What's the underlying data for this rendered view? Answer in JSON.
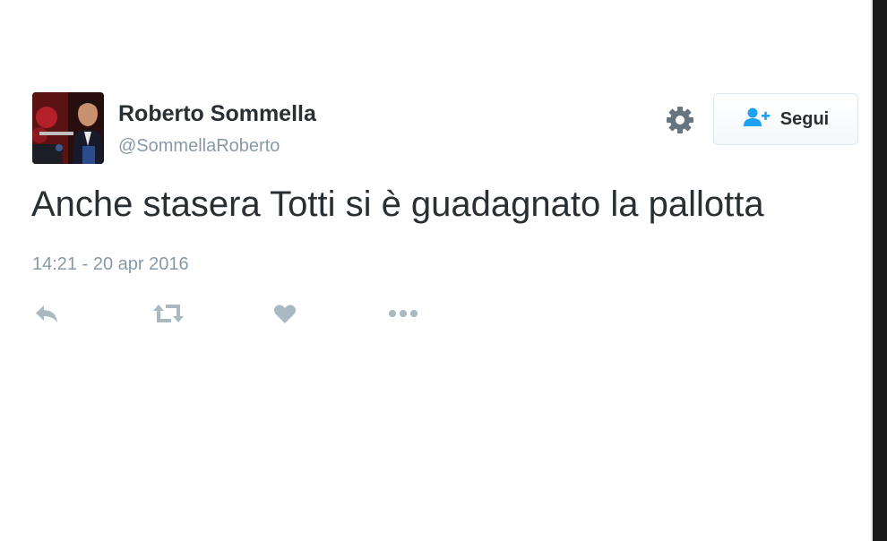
{
  "user": {
    "name": "Roberto Sommella",
    "handle": "@SommellaRoberto"
  },
  "follow_button": {
    "label": "Segui"
  },
  "tweet": {
    "text": "Anche stasera Totti si è guadagnato la pallotta",
    "timestamp": "14:21 - 20 apr 2016"
  },
  "actions": [
    "reply-icon",
    "retweet-icon",
    "like-icon",
    "more-icon"
  ],
  "colors": {
    "text_primary": "#292f33",
    "text_secondary": "#8899a6",
    "icon_gray": "#aab8c2",
    "follow_icon_blue": "#1da1f2"
  }
}
